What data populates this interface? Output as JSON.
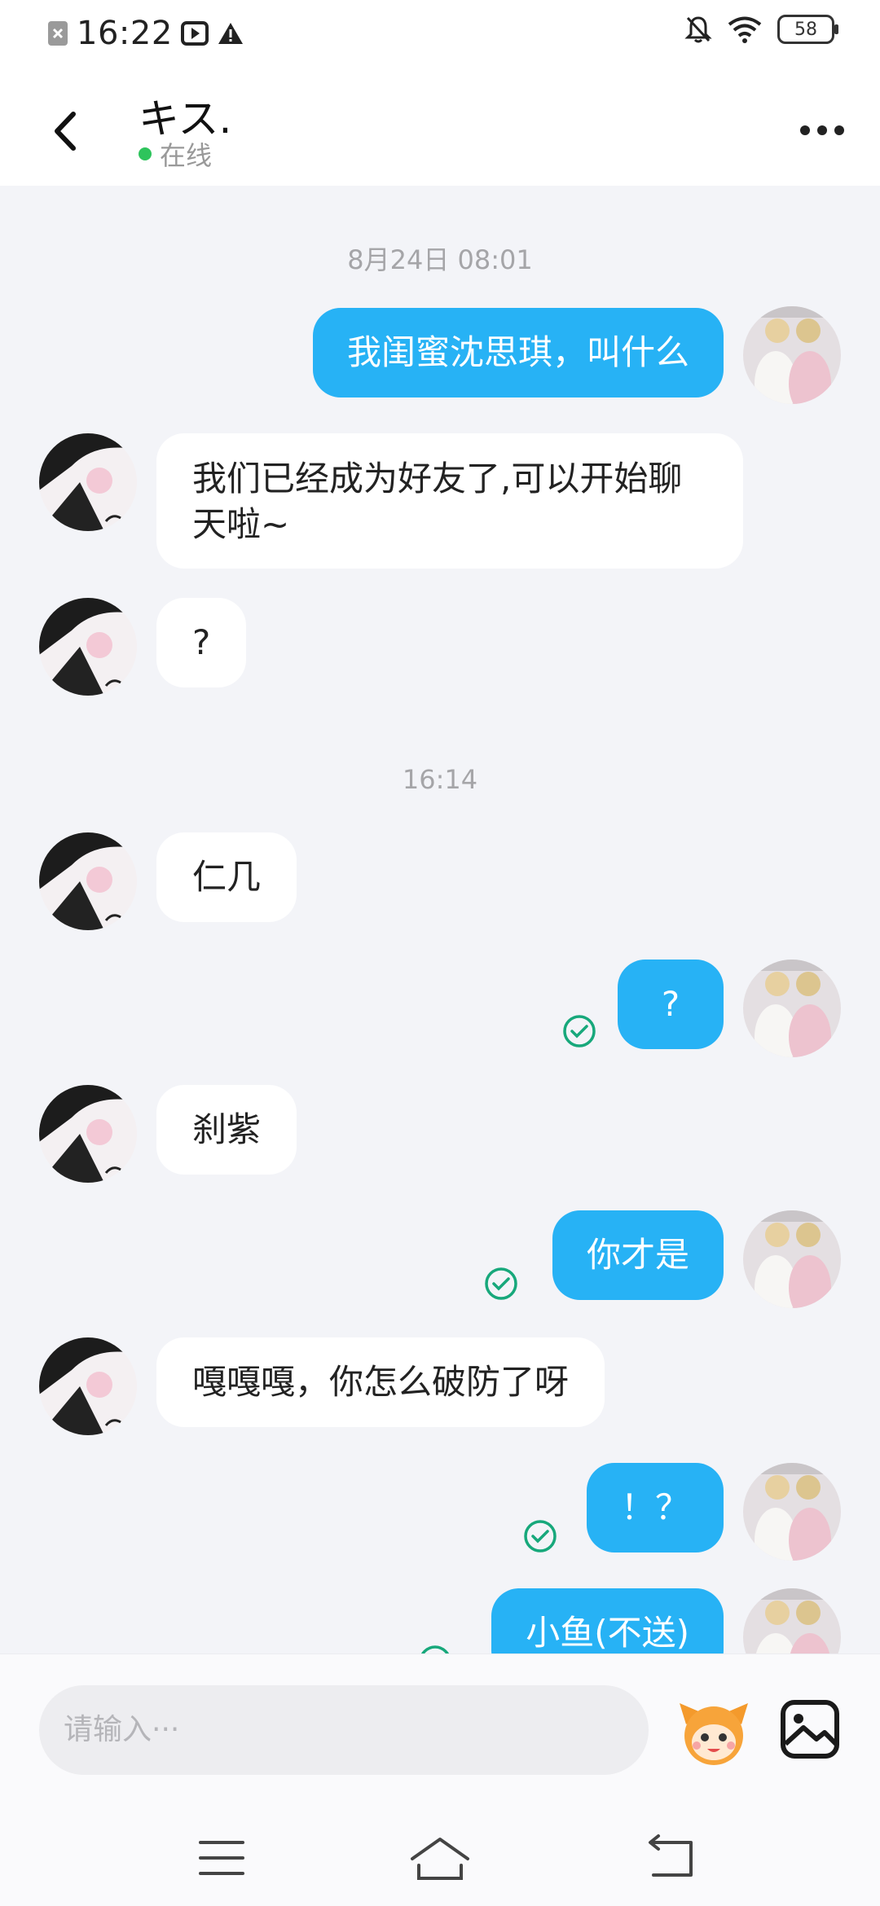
{
  "status_bar": {
    "time": "16:22",
    "battery": "58"
  },
  "header": {
    "title": "キス.",
    "status": "在线"
  },
  "messages": [
    {
      "text": "8月24日 08:01"
    },
    {
      "text": "我闺蜜沈思琪，叫什么"
    },
    {
      "text": "我们已经成为好友了,可以开始聊天啦~"
    },
    {
      "text": "?"
    },
    {
      "text": "16:14"
    },
    {
      "text": "仁几"
    },
    {
      "text": "?"
    },
    {
      "text": "刹紫"
    },
    {
      "text": "你才是"
    },
    {
      "text": "嘎嘎嘎，你怎么破防了呀"
    },
    {
      "text": "！？"
    },
    {
      "text": "小鱼(不送)"
    }
  ],
  "input": {
    "placeholder": "请输入···"
  },
  "colors": {
    "accent": "#27b2f5",
    "online": "#2ec45c",
    "check": "#17a87b"
  },
  "icons": [
    "back-arrow-icon",
    "more-icon",
    "read-check-icon",
    "emoji-mascot-icon",
    "image-icon",
    "menu-icon",
    "home-icon",
    "return-icon"
  ]
}
